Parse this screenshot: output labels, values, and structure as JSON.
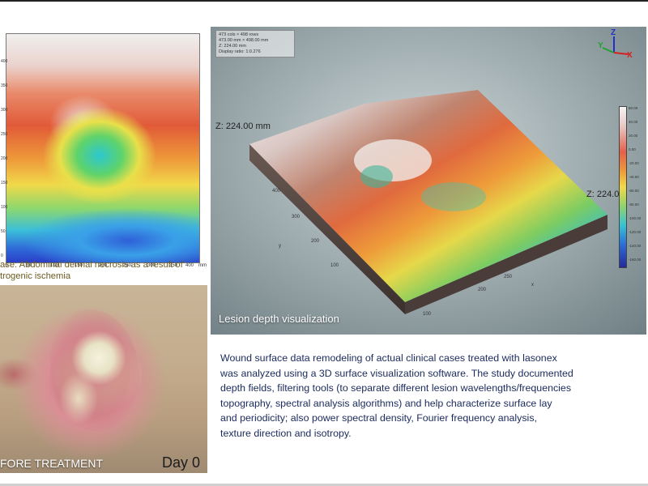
{
  "top_map": {
    "x_ticks": [
      "0",
      "30",
      "100",
      "150",
      "200",
      "250",
      "300",
      "350",
      "400",
      "mm"
    ],
    "y_ticks": [
      "400",
      "350",
      "300",
      "250",
      "200",
      "150",
      "100",
      "50",
      "0"
    ]
  },
  "caption": {
    "line1": "ase: Abdominal dermal necrosis as a result of",
    "line2": "trogenic ischemia"
  },
  "photo": {
    "label_left": "FORE TREATMENT",
    "label_right": "Day 0"
  },
  "viz": {
    "info_lines": [
      "473 cols × 498 rows",
      "473.00 mm × 498.00 mm",
      "Z: 224.00 mm",
      "Display ratio: 1:0.276"
    ],
    "z_label_left": "Z: 224.00 mm",
    "z_label_right": "Z: 224.00",
    "axis_x": "X",
    "axis_y": "Y",
    "axis_z": "Z",
    "colorbar_ticks": [
      "60.00",
      "40.00",
      "20.00",
      "0.00",
      "-20.00",
      "-40.00",
      "-60.00",
      "-80.00",
      "-100.00",
      "-120.00",
      "-140.00",
      "-160.00"
    ],
    "y_axis_ticks": [
      "400",
      "300",
      "200",
      "100",
      "y"
    ],
    "x_axis_ticks": [
      "100",
      "200",
      "250",
      "x"
    ],
    "title": "Lesion depth visualization",
    "colors": {
      "panel": "#9aa8ab",
      "side": "#5a4a45",
      "axis_x": "#d62020",
      "axis_y": "#22a030",
      "axis_z": "#2030c8"
    }
  },
  "description": {
    "lines": [
      "Wound surface data remodeling of actual clinical cases treated with lasonex",
      "was analyzed using a 3D surface visualization software. The study documented",
      "depth fields, filtering tools (to separate different lesion wavelengths/frequencies",
      "topography, spectral analysis algorithms) and help characterize surface lay",
      "and periodicity; also power spectral density, Fourier frequency analysis,",
      "texture direction and isotropy."
    ]
  }
}
